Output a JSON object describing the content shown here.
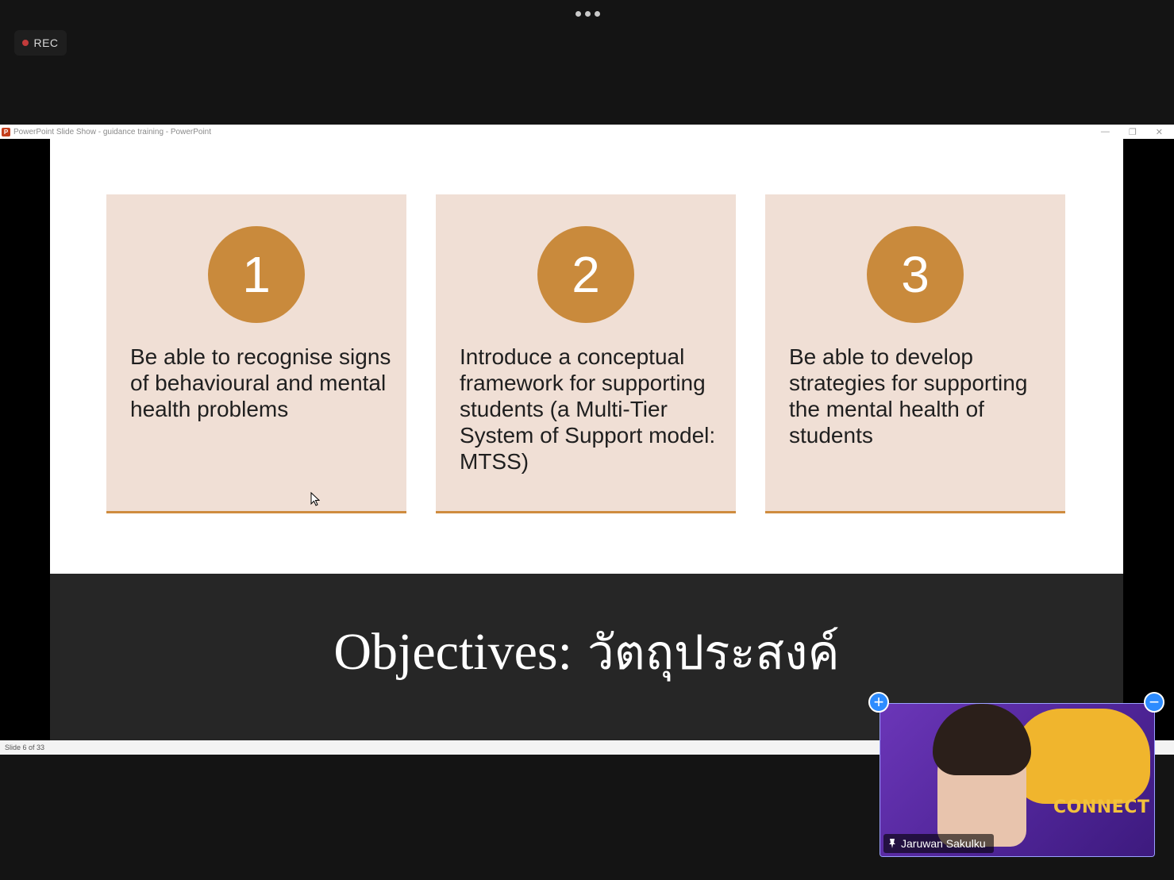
{
  "recording": {
    "label": "REC"
  },
  "ppt_window": {
    "title": "PowerPoint Slide Show  -  guidance training - PowerPoint",
    "status": "Slide 6 of 33"
  },
  "slide": {
    "title_en": "Objectives:",
    "title_th": "วัตถุประสงค์",
    "cards": [
      {
        "number": "1",
        "text": "Be able to recognise signs of behavioural and mental health problems"
      },
      {
        "number": "2",
        "text": "Introduce a conceptual framework for supporting students (a Multi-Tier System of Support model: MTSS)"
      },
      {
        "number": "3",
        "text": "Be able to develop strategies for supporting the mental health of students"
      }
    ]
  },
  "video": {
    "participant_name": "Jaruwan Sakulku",
    "background_text": "CONNECT"
  },
  "colors": {
    "card_bg": "#f0dfd5",
    "accent": "#c98a3c",
    "title_band": "#262626",
    "zoom_blue": "#2d8cff"
  }
}
